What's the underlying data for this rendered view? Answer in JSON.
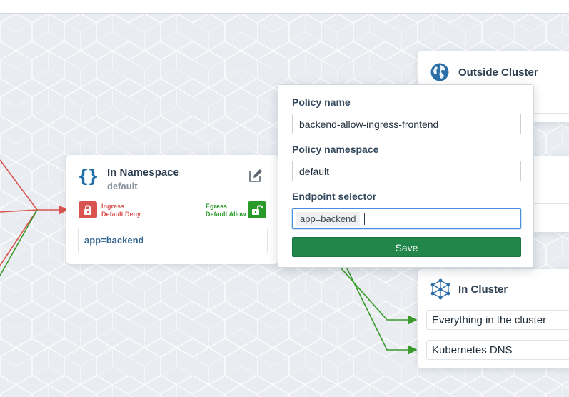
{
  "namespace_card": {
    "title": "In Namespace",
    "subtitle": "default",
    "ingress": {
      "label": "Ingress",
      "policy": "Default Deny",
      "color": "#d9534f"
    },
    "egress": {
      "label": "Egress",
      "policy": "Default Allow",
      "color": "#2a9a2a"
    },
    "endpoint_selector": "app=backend"
  },
  "outside_cluster": {
    "title": "Outside Cluster"
  },
  "in_cluster": {
    "title": "In Cluster",
    "items": [
      {
        "label": "Everything in the cluster"
      },
      {
        "label": "Kubernetes DNS"
      }
    ]
  },
  "policy_form": {
    "name_label": "Policy name",
    "name_value": "backend-allow-ingress-frontend",
    "namespace_label": "Policy namespace",
    "namespace_value": "default",
    "selector_label": "Endpoint selector",
    "selector_tags": [
      "app=backend"
    ],
    "save_label": "Save"
  },
  "colors": {
    "save_button": "#20864a",
    "deny_edge": "#d9534f",
    "allow_edge": "#3a9a2a",
    "accent": "#1d6ea8"
  }
}
